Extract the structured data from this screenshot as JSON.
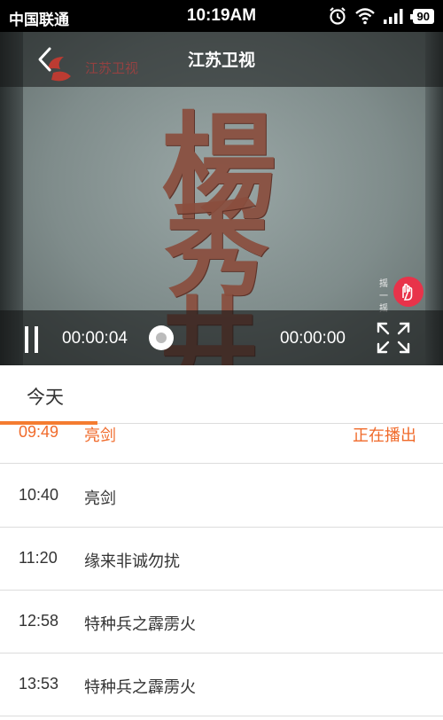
{
  "status_bar": {
    "carrier": "中国联通",
    "time": "10:19AM",
    "battery": "90",
    "icons": [
      "alarm-icon",
      "wifi-icon",
      "signal-icon",
      "battery-icon"
    ]
  },
  "player": {
    "title": "江苏卫视",
    "watermark": "江苏卫视",
    "video_text": [
      "楊",
      "秀",
      "井"
    ],
    "shake_label": "摇一摇",
    "current_time": "00:00:04",
    "total_time": "00:00:00",
    "progress": 0,
    "icons": [
      "back-icon",
      "pause-icon",
      "fullscreen-icon"
    ]
  },
  "tabs": [
    {
      "label": "今天",
      "selected": true
    }
  ],
  "schedule": [
    {
      "time": "09:49",
      "title": "亮剑",
      "status": "正在播出",
      "active": true
    },
    {
      "time": "10:40",
      "title": "亮剑",
      "status": "",
      "active": false
    },
    {
      "time": "11:20",
      "title": "缘来非诚勿扰",
      "status": "",
      "active": false
    },
    {
      "time": "12:58",
      "title": "特种兵之霹雳火",
      "status": "",
      "active": false
    },
    {
      "time": "13:53",
      "title": "特种兵之霹雳火",
      "status": "",
      "active": false
    }
  ],
  "colors": {
    "accent": "#f06a2a",
    "tab_underline": "#f47c30",
    "status_bar": "#000000"
  }
}
